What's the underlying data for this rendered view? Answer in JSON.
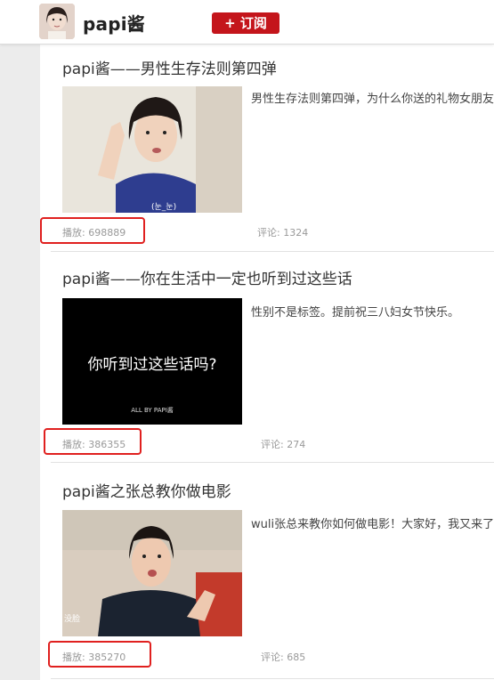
{
  "header": {
    "channel_name": "papi酱",
    "subscribe_label": "+ 订阅"
  },
  "videos": [
    {
      "title": "papi酱——男性生存法则第四弹",
      "description": "男性生存法则第四弹，为什么你送的礼物女朋友都不喜欢",
      "plays": "播放: 698889",
      "comments": "评论: 1324"
    },
    {
      "title": "papi酱——你在生活中一定也听到过这些话",
      "description": "性别不是标签。提前祝三八妇女节快乐。",
      "thumb_text": "你听到过这些话吗?",
      "thumb_credit": "ALL BY PAPI酱",
      "plays": "播放: 386355",
      "comments": "评论: 274"
    },
    {
      "title": "papi酱之张总教你做电影",
      "description": "wuli张总来教你如何做电影！大家好，我又来了",
      "plays": "播放: 385270",
      "comments": "评论: 685"
    }
  ],
  "colors": {
    "subscribe_bg": "#c4151b",
    "highlight_box": "#e0201f"
  }
}
